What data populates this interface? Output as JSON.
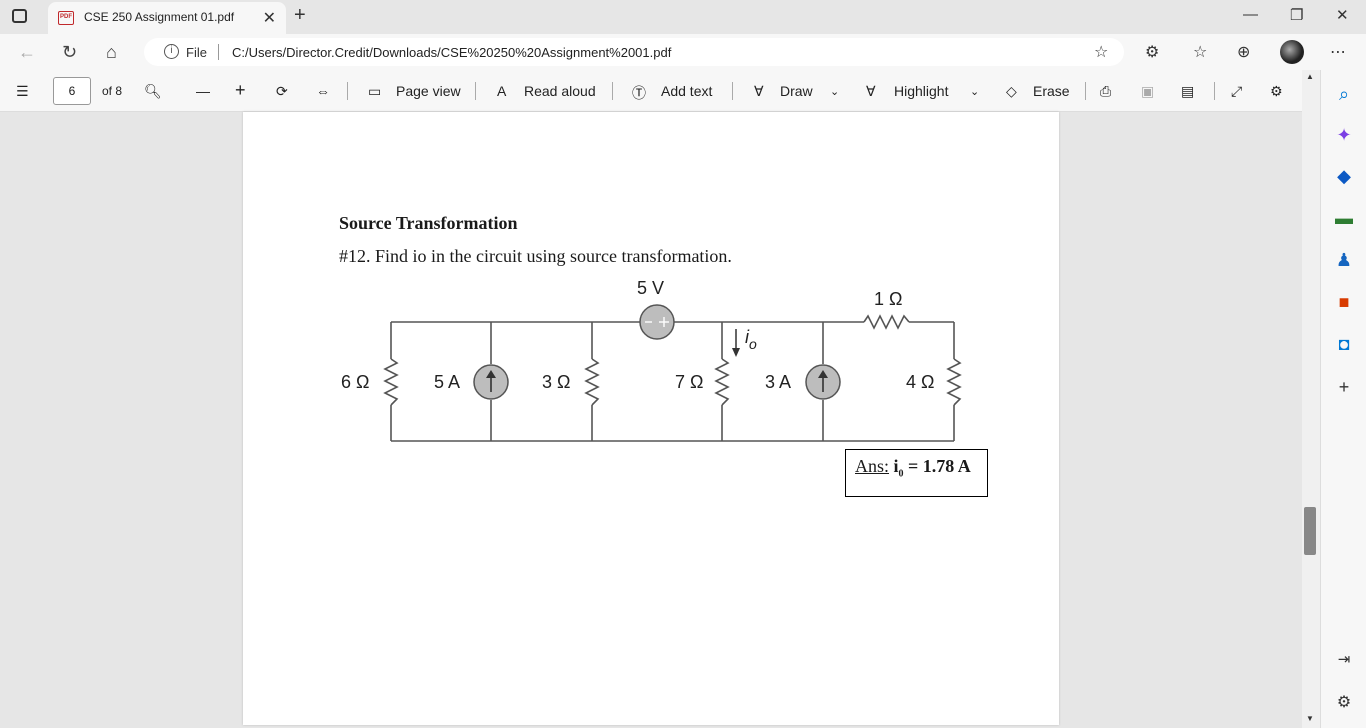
{
  "browser": {
    "tab_title": "CSE 250 Assignment 01.pdf",
    "pdf_badge": "PDF",
    "url_scheme": "File",
    "url_path": "C:/Users/Director.Credit/Downloads/CSE%20250%20Assignment%2001.pdf"
  },
  "toolbar": {
    "page_number": "6",
    "page_total": "of 8",
    "page_view": "Page view",
    "read_aloud": "Read aloud",
    "add_text": "Add text",
    "draw": "Draw",
    "highlight": "Highlight",
    "erase": "Erase"
  },
  "document": {
    "heading": "Source Transformation",
    "question": "#12. Find io in the circuit using source transformation.",
    "circuit": {
      "v_source": "5 V",
      "r_1": "1 Ω",
      "r_6": "6 Ω",
      "i_5": "5 A",
      "r_3": "3 Ω",
      "r_7": "7 Ω",
      "i_3": "3 A",
      "r_4": "4 Ω",
      "io_label": "i",
      "io_sub": "o"
    },
    "answer": {
      "prefix": "Ans:",
      "var": "i",
      "sub": "0",
      "value": "= 1.78 A"
    }
  },
  "colors": {
    "accent": "#0078d4",
    "pdf_red": "#c0282b"
  }
}
